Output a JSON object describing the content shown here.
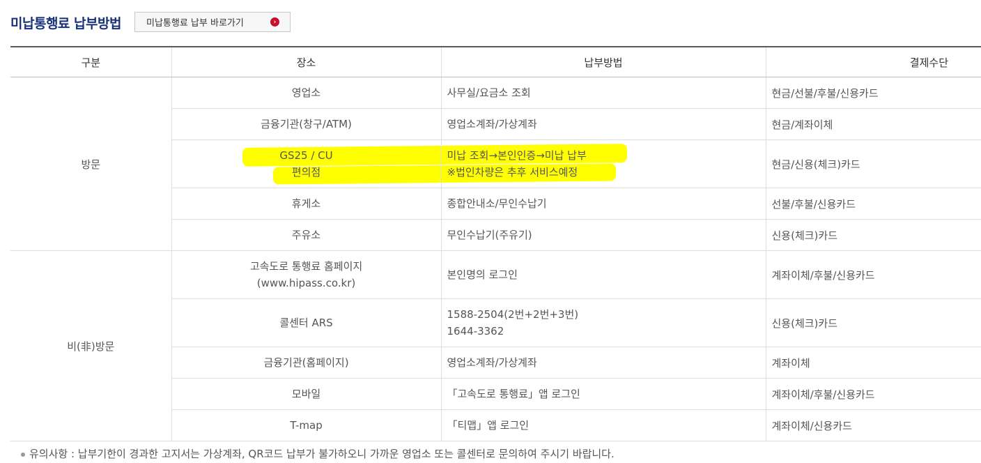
{
  "header": {
    "title": "미납통행료 납부방법",
    "shortcut_label": "미납통행료 납부 바로가기",
    "arrow_icon": "chevron-right-circle-icon",
    "accent": "#c8102e"
  },
  "table": {
    "columns": [
      "구분",
      "장소",
      "납부방법",
      "결제수단"
    ],
    "groups": [
      {
        "category": "방문",
        "rows": [
          {
            "place": [
              "영업소"
            ],
            "method": [
              "사무실/요금소 조회"
            ],
            "pay": "현금/선불/후불/신용카드"
          },
          {
            "place": [
              "금융기관(창구/ATM)"
            ],
            "method": [
              "영업소계좌/가상계좌"
            ],
            "pay": "현금/계좌이체"
          },
          {
            "place": [
              "GS25 / CU",
              "편의점"
            ],
            "method": [
              "미납 조회→본인인증→미납 납부",
              "※법인차량은 추후 서비스예정"
            ],
            "pay": "현금/신용(체크)카드"
          },
          {
            "place": [
              "휴게소"
            ],
            "method": [
              "종합안내소/무인수납기"
            ],
            "pay": "선불/후불/신용카드"
          },
          {
            "place": [
              "주유소"
            ],
            "method": [
              "무인수납기(주유기)"
            ],
            "pay": "신용(체크)카드"
          }
        ]
      },
      {
        "category": "비(非)방문",
        "rows": [
          {
            "place": [
              "고속도로 통행료 홈페이지",
              "(www.hipass.co.kr)"
            ],
            "method": [
              "본인명의 로그인"
            ],
            "pay": "계좌이체/후불/신용카드"
          },
          {
            "place": [
              "콜센터 ARS"
            ],
            "method": [
              "1588-2504(2번+2번+3번)",
              "1644-3362"
            ],
            "pay": "신용(체크)카드"
          },
          {
            "place": [
              "금융기관(홈페이지)"
            ],
            "method": [
              "영업소계좌/가상계좌"
            ],
            "pay": "계좌이체"
          },
          {
            "place": [
              "모바일"
            ],
            "method": [
              "「고속도로 통행료」앱 로그인"
            ],
            "pay": "계좌이체/후불/신용카드"
          },
          {
            "place": [
              "T-map"
            ],
            "method": [
              "「티맵」앱 로그인"
            ],
            "pay": "계좌이체/신용카드"
          }
        ]
      }
    ]
  },
  "notice": "유의사항 : 납부기한이 경과한 고지서는 가상계좌, QR코드 납부가 불가하오니 가까운 영업소 또는 콜센터로 문의하여 주시기 바랍니다.",
  "highlight_color": "#ffff00"
}
